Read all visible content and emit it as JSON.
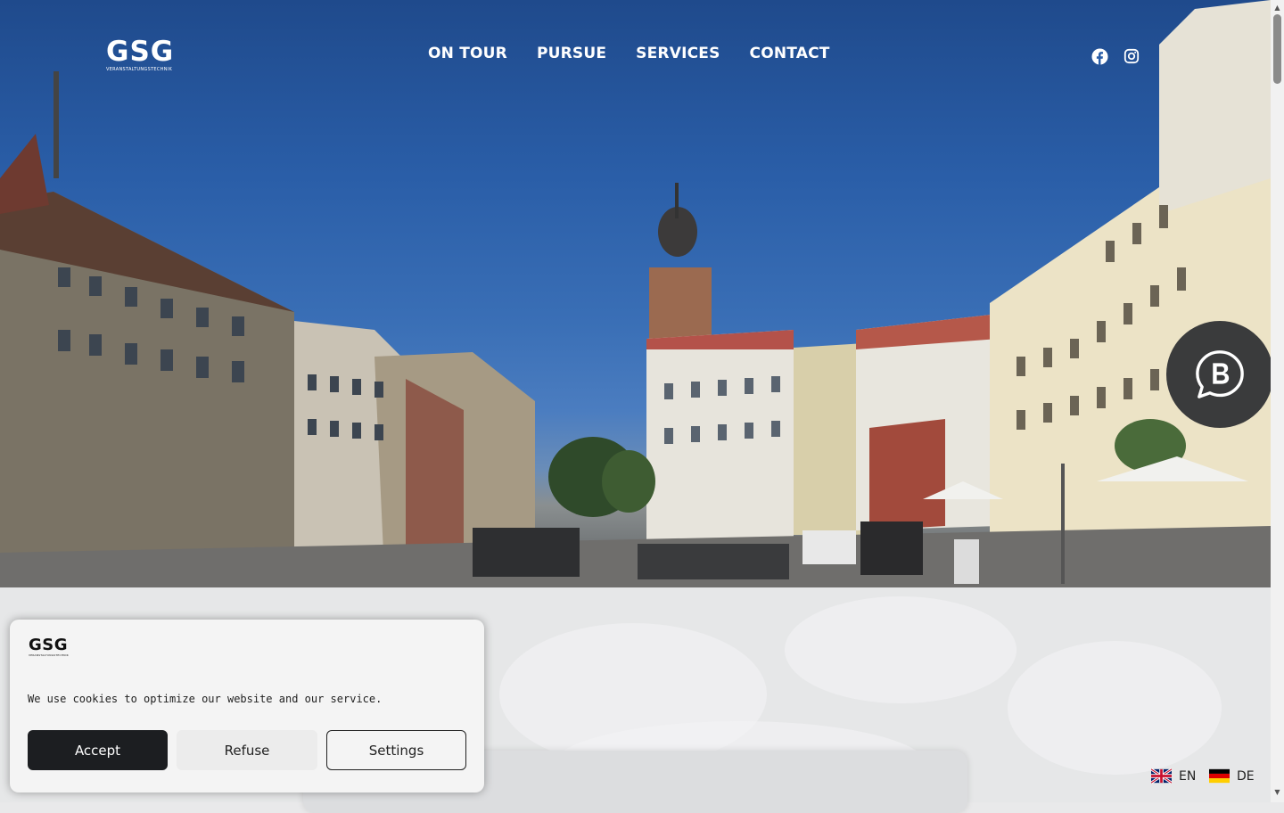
{
  "header": {
    "logo_mark": "GSG",
    "logo_sub": "VERANSTALTUNGSTECHNIK",
    "nav": [
      {
        "label": "ON TOUR"
      },
      {
        "label": "PURSUE"
      },
      {
        "label": "SERVICES"
      },
      {
        "label": "CONTACT"
      }
    ],
    "social": [
      {
        "icon": "facebook-icon"
      },
      {
        "icon": "instagram-icon"
      }
    ]
  },
  "hero": {
    "type": "video-background",
    "scene_colors": {
      "sky": "#2a5ea8",
      "buildings": "#cfc9b8"
    }
  },
  "cookie_banner": {
    "logo_mark": "GSG",
    "logo_sub": "VERANSTALTUNGSTECHNIK",
    "message": "We use cookies to optimize our website and our service.",
    "accept_label": "Accept",
    "refuse_label": "Refuse",
    "settings_label": "Settings"
  },
  "language_switcher": {
    "items": [
      {
        "code": "EN",
        "flag": "uk-flag-icon"
      },
      {
        "code": "DE",
        "flag": "germany-flag-icon"
      }
    ]
  },
  "chat_widget": {
    "icon": "chat-b-icon"
  },
  "colors": {
    "accept_bg": "#1c1e21",
    "banner_bg": "#f4f4f4",
    "chat_bg": "#3a3b3c"
  }
}
